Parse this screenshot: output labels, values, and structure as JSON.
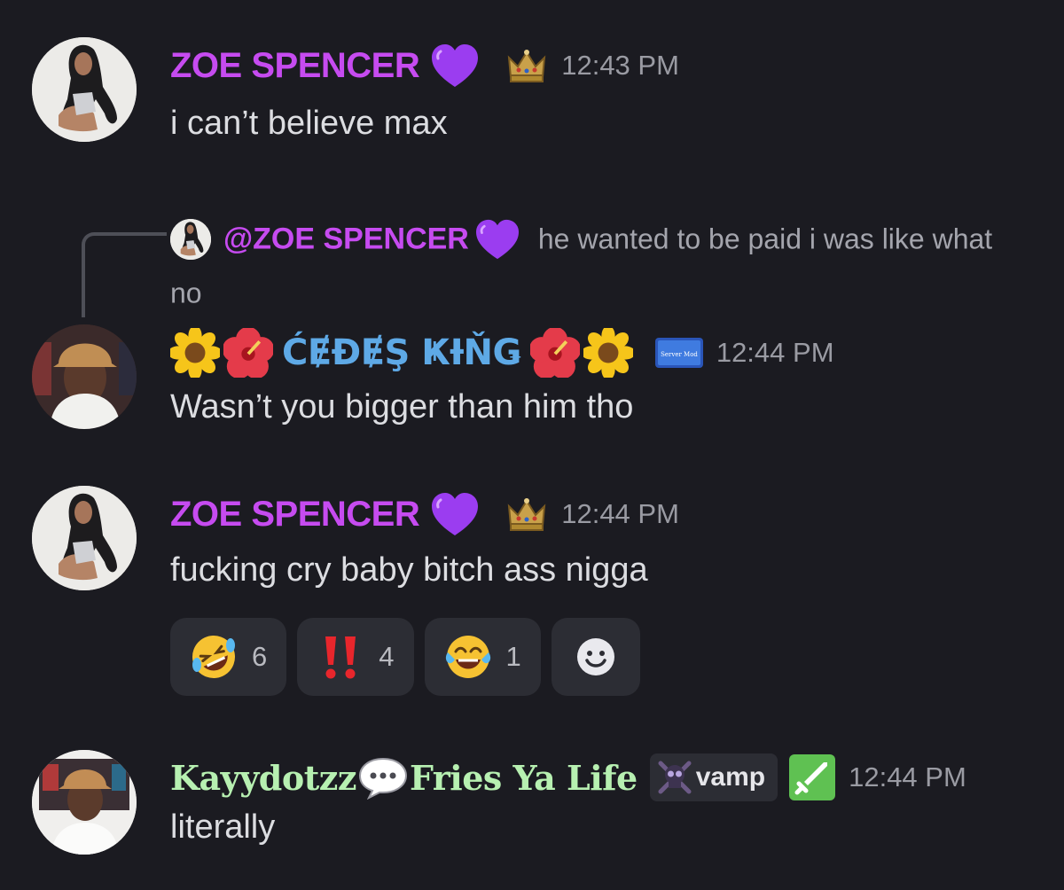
{
  "messages": [
    {
      "author": "ZOE SPENCER",
      "timestamp": "12:43 PM",
      "text": "i can’t believe max"
    },
    {
      "reply": {
        "author": "@ZOE SPENCER",
        "text": "he wanted to be paid i was like what no"
      },
      "author": "ĆɆĐɆŞ ҜƗŇǤ",
      "role_badge": "Server Mod",
      "timestamp": "12:44 PM",
      "text": "Wasn’t you bigger than him tho"
    },
    {
      "author": "ZOE SPENCER",
      "timestamp": "12:44 PM",
      "text": "fucking cry baby bitch ass nigga",
      "reactions": [
        {
          "icon": "rofl-emoji",
          "count": "6"
        },
        {
          "icon": "double-exclamation-emoji",
          "count": "4"
        },
        {
          "icon": "joy-emoji",
          "count": "1"
        },
        {
          "icon": "add-reaction-icon"
        }
      ]
    },
    {
      "author_part1": "Kayydotzz",
      "author_part2": "Fries Ya Life",
      "tag": "vamp",
      "timestamp": "12:44 PM",
      "text": "literally"
    }
  ],
  "colors": {
    "background": "#1b1b21",
    "zoe_name": "#c64bf0",
    "cedes_name": "#5ea9e6",
    "kay_name": "#b7f0b1"
  }
}
